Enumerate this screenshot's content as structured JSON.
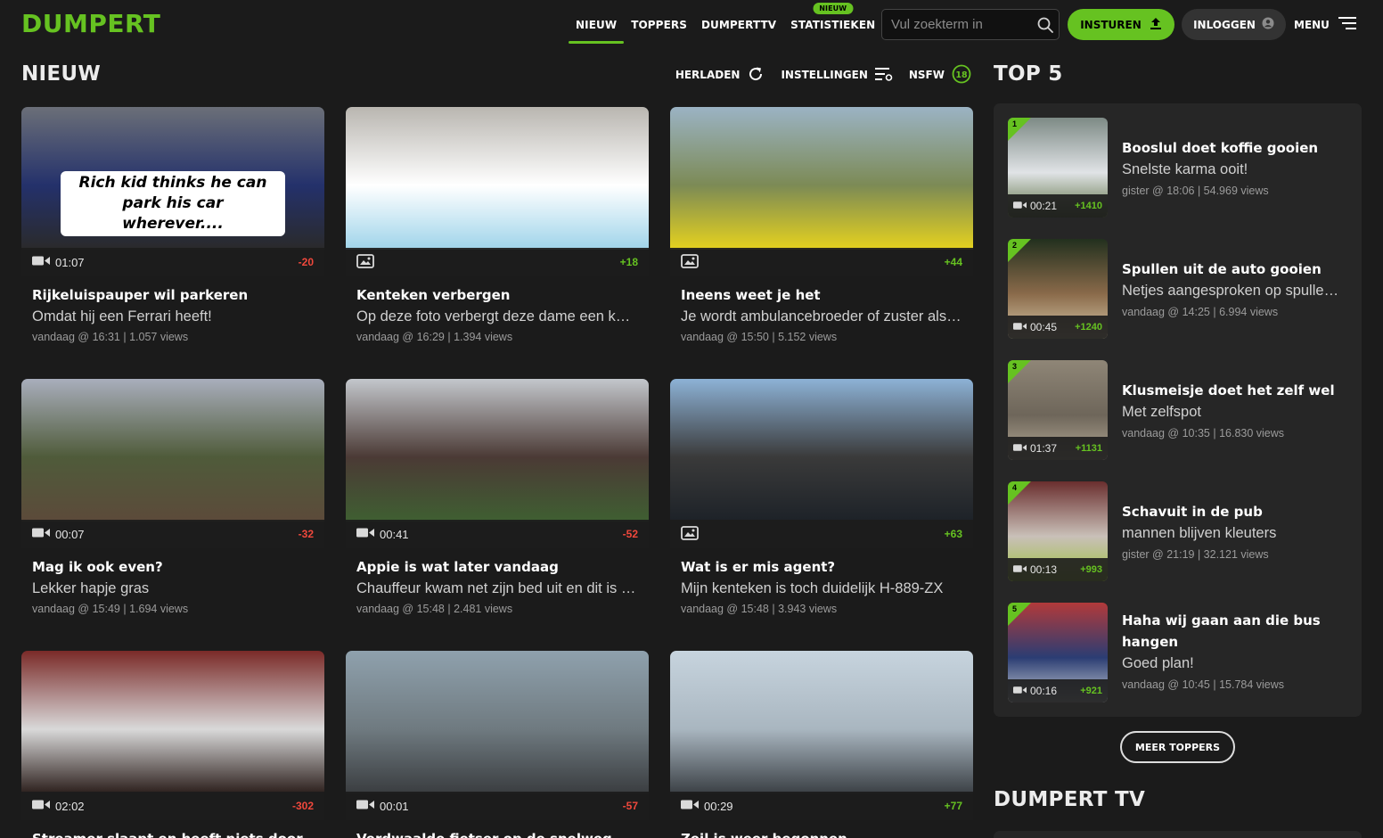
{
  "header": {
    "logo": "DUMPERT",
    "nav": [
      {
        "label": "NIEUW",
        "active": true,
        "badge": ""
      },
      {
        "label": "TOPPERS",
        "active": false,
        "badge": ""
      },
      {
        "label": "DUMPERTTV",
        "active": false,
        "badge": ""
      },
      {
        "label": "STATISTIEKEN",
        "active": false,
        "badge": "NIEUW"
      }
    ],
    "search_placeholder": "Vul zoekterm in",
    "submit_label": "INSTUREN",
    "login_label": "INLOGGEN",
    "menu_label": "MENU"
  },
  "section": {
    "title": "NIEUW",
    "reload_label": "HERLADEN",
    "settings_label": "INSTELLINGEN",
    "nsfw_label": "NSFW"
  },
  "videos": [
    {
      "title": "Rijkeluispauper wil parkeren",
      "description": "Omdat hij een Ferrari heeft!",
      "meta": "vandaag @ 16:31 | 1.057 views",
      "media": "video",
      "duration": "01:07",
      "score": "-20",
      "overlay_caption": "Rich kid thinks he can park his car wherever....",
      "thumb_palette": [
        "#6b6f78",
        "#24316b",
        "#2a2a2a"
      ]
    },
    {
      "title": "Kenteken verbergen",
      "description": "Op deze foto verbergt deze dame een kenteken",
      "meta": "vandaag @ 16:29 | 1.394 views",
      "media": "photo",
      "duration": "",
      "score": "+18",
      "overlay_caption": "",
      "thumb_palette": [
        "#b9b6b0",
        "#ffffff",
        "#9fd4ea"
      ]
    },
    {
      "title": "Ineens weet je het",
      "description": "Je wordt ambulancebroeder of zuster als je later groot bent",
      "meta": "vandaag @ 15:50 | 5.152 views",
      "media": "photo",
      "duration": "",
      "score": "+44",
      "overlay_caption": "",
      "thumb_palette": [
        "#9bb3c4",
        "#7c8a55",
        "#e6d21e"
      ]
    },
    {
      "title": "Mag ik ook even?",
      "description": "Lekker hapje gras",
      "meta": "vandaag @ 15:49 | 1.694 views",
      "media": "video",
      "duration": "00:07",
      "score": "-32",
      "overlay_caption": "",
      "thumb_palette": [
        "#a9aebc",
        "#4f5b3a",
        "#5c4a3a"
      ]
    },
    {
      "title": "Appie is wat later vandaag",
      "description": "Chauffeur kwam net zijn bed uit en dit is het resultaat",
      "meta": "vandaag @ 15:48 | 2.481 views",
      "media": "video",
      "duration": "00:41",
      "score": "-52",
      "overlay_caption": "",
      "thumb_palette": [
        "#c3c7cc",
        "#4b3a35",
        "#3f5f32"
      ]
    },
    {
      "title": "Wat is er mis agent?",
      "description": "Mijn kenteken is toch duidelijk H-889-ZX",
      "meta": "vandaag @ 15:48 | 3.943 views",
      "media": "photo",
      "duration": "",
      "score": "+63",
      "overlay_caption": "",
      "thumb_palette": [
        "#8db2d6",
        "#3a3a3a",
        "#1d2228"
      ]
    },
    {
      "title": "Streamer slaapt en heeft niets door",
      "description": "",
      "meta": "",
      "media": "video",
      "duration": "02:02",
      "score": "-302",
      "overlay_caption": "",
      "thumb_palette": [
        "#7a2a28",
        "#d9d9d9",
        "#2c1f1c"
      ]
    },
    {
      "title": "Verdwaalde fietser op de snelweg",
      "description": "",
      "meta": "",
      "media": "video",
      "duration": "00:01",
      "score": "-57",
      "overlay_caption": "",
      "thumb_palette": [
        "#8fa1ad",
        "#6f7a80",
        "#3a3d40"
      ]
    },
    {
      "title": "Zeil is weer begonnen",
      "description": "",
      "meta": "",
      "media": "video",
      "duration": "00:29",
      "score": "+77",
      "overlay_caption": "",
      "thumb_palette": [
        "#c7d4de",
        "#a9b6c0",
        "#3b4045"
      ]
    }
  ],
  "top5": {
    "title": "TOP 5",
    "items": [
      {
        "rank": "1",
        "title": "Booslul doet koffie gooien",
        "description": "Snelste karma ooit!",
        "meta": "gister @ 18:06 | 54.969 views",
        "duration": "00:21",
        "score": "+1410",
        "thumb_palette": [
          "#7d8a85",
          "#e0e3e6",
          "#566b3a"
        ]
      },
      {
        "rank": "2",
        "title": "Spullen uit de auto gooien",
        "description": "Netjes aangesproken op spullen uit het raam gooien",
        "meta": "vandaag @ 14:25 | 6.994 views",
        "duration": "00:45",
        "score": "+1240",
        "thumb_palette": [
          "#22301e",
          "#8a6a4a",
          "#d7c9a8"
        ]
      },
      {
        "rank": "3",
        "title": "Klusmeisje doet het zelf wel",
        "description": "Met zelfspot",
        "meta": "vandaag @ 10:35 | 16.830 views",
        "duration": "01:37",
        "score": "+1131",
        "thumb_palette": [
          "#8f8677",
          "#6e665a",
          "#b6ab98"
        ]
      },
      {
        "rank": "4",
        "title": "Schavuit in de pub",
        "description": "mannen blijven kleuters",
        "meta": "gister @ 21:19 | 32.121 views",
        "duration": "00:13",
        "score": "+993",
        "thumb_palette": [
          "#6a2e2e",
          "#c9c0b8",
          "#9dc23c"
        ]
      },
      {
        "rank": "5",
        "title": "Haha wij gaan aan die bus hangen",
        "description": "Goed plan!",
        "meta": "vandaag @ 10:45 | 15.784 views",
        "duration": "00:16",
        "score": "+921",
        "thumb_palette": [
          "#b23a3a",
          "#2b3d73",
          "#c9cfd6"
        ]
      }
    ],
    "more_label": "MEER TOPPERS"
  },
  "tv": {
    "title": "DUMPERT TV"
  },
  "colors": {
    "accent": "#66c221",
    "negative": "#f0483c",
    "background": "#1b1b1b",
    "panel": "#262626"
  }
}
